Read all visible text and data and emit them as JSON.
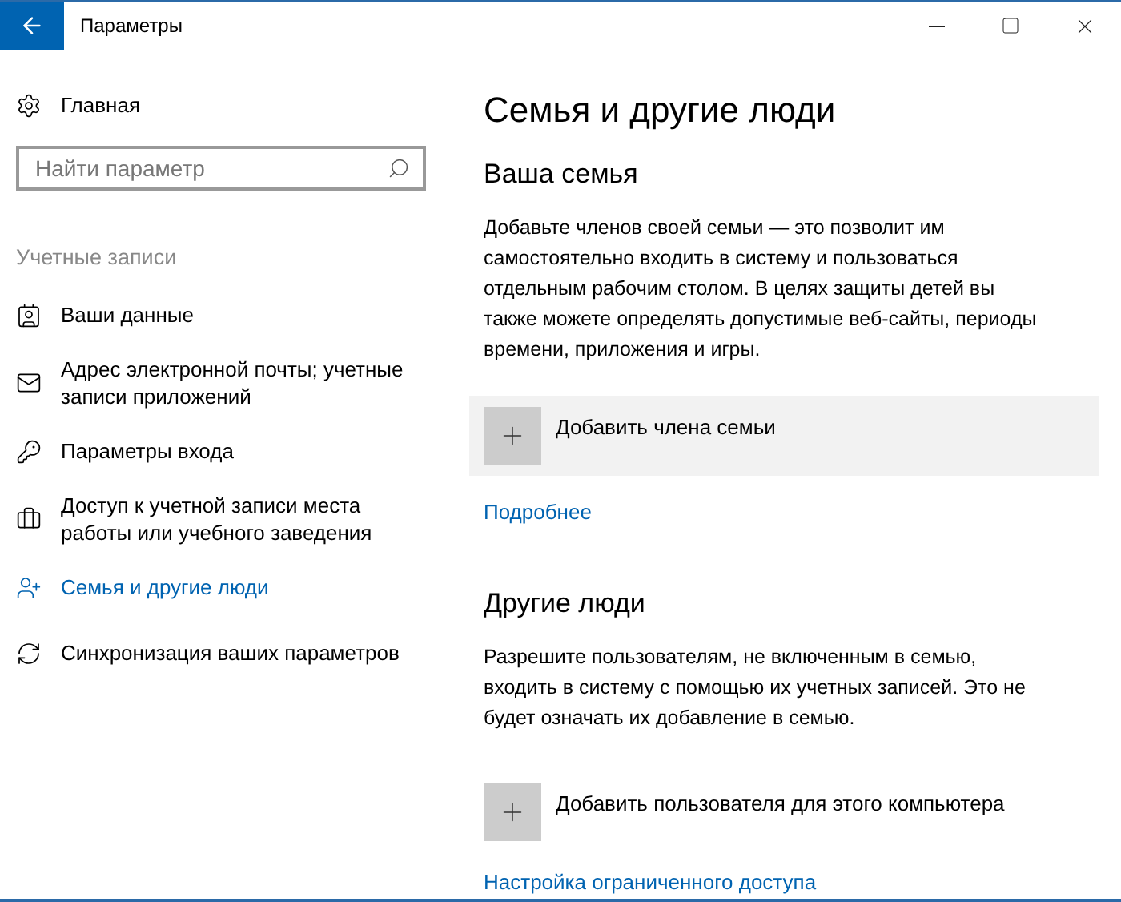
{
  "window": {
    "title": "Параметры"
  },
  "sidebar": {
    "home": "Главная",
    "search": {
      "placeholder": "Найти параметр"
    },
    "section": "Учетные записи",
    "items": [
      {
        "label": "Ваши данные",
        "selected": false
      },
      {
        "label": "Адрес электронной почты; учетные записи приложений",
        "selected": false
      },
      {
        "label": "Параметры входа",
        "selected": false
      },
      {
        "label": "Доступ к учетной записи места работы или учебного заведения",
        "selected": false
      },
      {
        "label": "Семья и другие люди",
        "selected": true
      },
      {
        "label": "Синхронизация ваших параметров",
        "selected": false
      }
    ]
  },
  "main": {
    "title": "Семья и другие люди",
    "sections": [
      {
        "heading": "Ваша семья",
        "text": "Добавьте членов своей семьи — это позволит им самостоятельно входить в систему и пользоваться отдельным рабочим столом. В целях защиты детей вы также можете определять допустимые веб-сайты, периоды времени, приложения и игры.",
        "action": "Добавить члена семьи",
        "highlighted": true,
        "link": "Подробнее"
      },
      {
        "heading": "Другие люди",
        "text": "Разрешите пользователям, не включенным в семью, входить в систему с помощью их учетных записей. Это не будет означать их добавление в семью.",
        "action": "Добавить пользователя для этого компьютера",
        "highlighted": false,
        "link": "Настройка ограниченного доступа"
      }
    ]
  }
}
